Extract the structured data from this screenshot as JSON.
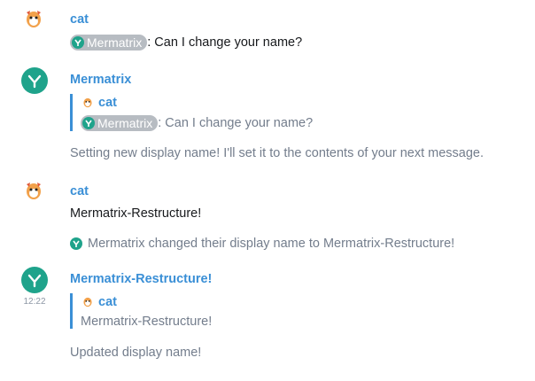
{
  "messages": [
    {
      "sender": "cat",
      "pill": "Mermatrix",
      "text": ": Can I change your name?"
    },
    {
      "sender": "Mermatrix",
      "quote_sender": "cat",
      "quote_pill": "Mermatrix",
      "quote_text": ": Can I change your name?",
      "text": "Setting new display name! I'll set it to the contents of your next message."
    },
    {
      "sender": "cat",
      "text": "Mermatrix-Restructure!"
    },
    {
      "event": "Mermatrix changed their display name to Mermatrix-Restructure!"
    },
    {
      "sender": "Mermatrix-Restructure!",
      "timestamp": "12:22",
      "quote_sender": "cat",
      "quote_text": "Mermatrix-Restructure!",
      "text": "Updated display name!"
    }
  ],
  "colors": {
    "accent": "#3a8fd6",
    "bot": "#1fa38b",
    "muted": "#737d8c"
  },
  "icons": {
    "cat_avatar": "cat-avatar-icon",
    "bot_avatar": "mermatrix-logo-icon"
  }
}
